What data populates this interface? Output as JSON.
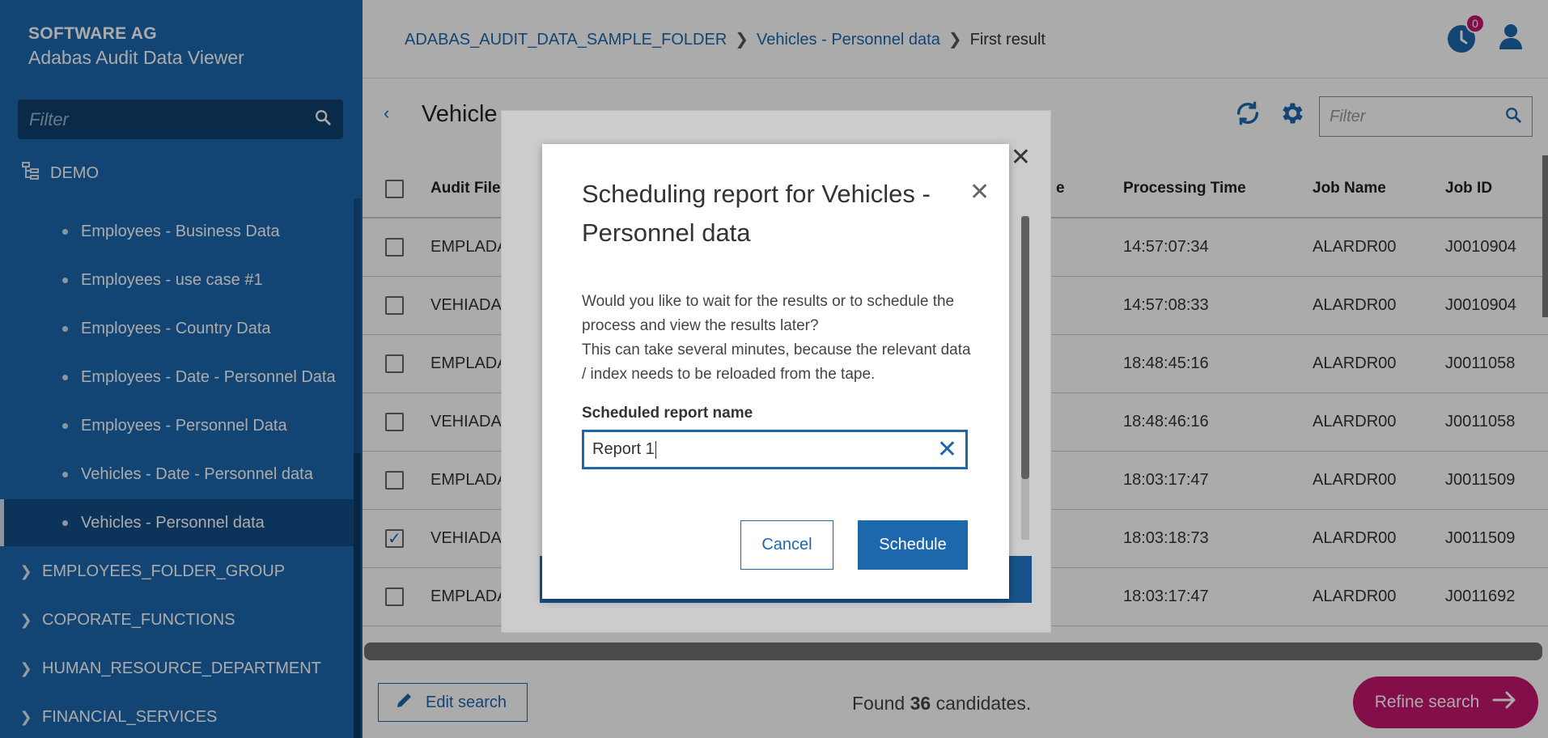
{
  "sidebar": {
    "company": "SOFTWARE AG",
    "product": "Adabas Audit Data Viewer",
    "filter_placeholder": "Filter",
    "root": "DEMO",
    "items": [
      {
        "label": "Employees - Business Data"
      },
      {
        "label": "Employees - use case #1"
      },
      {
        "label": "Employees - Country Data"
      },
      {
        "label": "Employees - Date - Personnel Data"
      },
      {
        "label": "Employees - Personnel Data"
      },
      {
        "label": "Vehicles - Date - Personnel data"
      },
      {
        "label": "Vehicles - Personnel data"
      }
    ],
    "folders": [
      {
        "label": "EMPLOYEES_FOLDER_GROUP"
      },
      {
        "label": "COPORATE_FUNCTIONS"
      },
      {
        "label": "HUMAN_RESOURCE_DEPARTMENT"
      },
      {
        "label": "FINANCIAL_SERVICES"
      }
    ]
  },
  "breadcrumb": {
    "items": [
      "ADABAS_AUDIT_DATA_SAMPLE_FOLDER",
      "Vehicles - Personnel data"
    ],
    "current": "First result"
  },
  "notifications": {
    "count": "0"
  },
  "page": {
    "title": "Vehicle",
    "filter_placeholder": "Filter"
  },
  "table": {
    "headers": {
      "audit_file": "Audit File",
      "col_partial": "e",
      "processing_time": "Processing Time",
      "job_name": "Job Name",
      "job_id": "Job ID"
    },
    "rows": [
      {
        "audit_file": "EMPLADA",
        "processing_time": "14:57:07:34",
        "job_name": "ALARDR00",
        "job_id": "J0010904",
        "checked": false
      },
      {
        "audit_file": "VEHIADA",
        "processing_time": "14:57:08:33",
        "job_name": "ALARDR00",
        "job_id": "J0010904",
        "checked": false
      },
      {
        "audit_file": "EMPLADA",
        "processing_time": "18:48:45:16",
        "job_name": "ALARDR00",
        "job_id": "J0011058",
        "checked": false
      },
      {
        "audit_file": "VEHIADA",
        "processing_time": "18:48:46:16",
        "job_name": "ALARDR00",
        "job_id": "J0011058",
        "checked": false
      },
      {
        "audit_file": "EMPLADA",
        "processing_time": "18:03:17:47",
        "job_name": "ALARDR00",
        "job_id": "J0011509",
        "checked": false
      },
      {
        "audit_file": "VEHIADA",
        "processing_time": "18:03:18:73",
        "job_name": "ALARDR00",
        "job_id": "J0011509",
        "checked": true
      },
      {
        "audit_file": "EMPLADA",
        "processing_time": "18:03:17:47",
        "job_name": "ALARDR00",
        "job_id": "J0011692",
        "checked": false
      }
    ]
  },
  "bottom": {
    "edit_search": "Edit search",
    "found_prefix": "Found ",
    "found_count": "36",
    "found_suffix": " candidates.",
    "refine_search": "Refine search"
  },
  "modal": {
    "title": "Scheduling report for Vehicles - Personnel data",
    "body_line1": "Would you like to wait for the results or to schedule the process and view the results later?",
    "body_line2": "This can take several minutes, because the relevant data / index needs to be reloaded from the tape.",
    "field_label": "Scheduled report name",
    "field_value": "Report 1",
    "cancel": "Cancel",
    "schedule": "Schedule"
  },
  "colors": {
    "primary": "#1d67ad",
    "accent": "#c4166e"
  }
}
